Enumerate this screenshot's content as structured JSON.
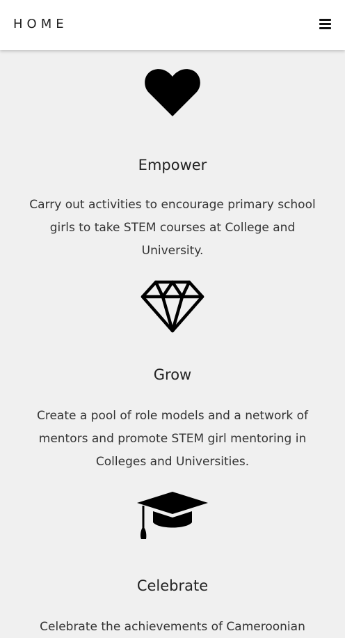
{
  "navbar": {
    "brand": "HOME",
    "menu_icon": "hamburger-menu-icon"
  },
  "features": [
    {
      "icon": "heart-icon",
      "title": "Empower",
      "description": "Carry out activities to encourage primary school girls to take STEM courses at College and University."
    },
    {
      "icon": "diamond-icon",
      "title": "Grow",
      "description": "Create a pool of role models and a network of mentors and promote STEM girl mentoring in Colleges and Universities."
    },
    {
      "icon": "graduation-cap-icon",
      "title": "Celebrate",
      "description": "Celebrate the achievements of Cameroonian"
    }
  ],
  "colors": {
    "navbar_bg": "#ffffff",
    "page_bg": "#f0f0f0",
    "text": "#222222",
    "icon": "#000000"
  }
}
